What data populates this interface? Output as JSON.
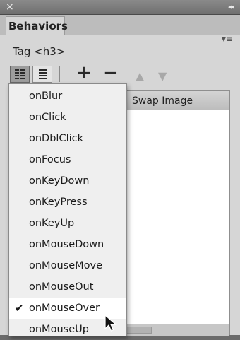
{
  "window": {
    "close_glyph": "×",
    "collapse_glyph": "◂◂"
  },
  "tabs": {
    "active_label": "Behaviors",
    "panel_menu_glyph": "▾≡"
  },
  "tag_label": "Tag <h3>",
  "toolbar": {
    "add_glyph": "+",
    "remove_glyph": "−",
    "up_glyph": "▲",
    "down_glyph": "▼"
  },
  "table": {
    "columns": [
      "",
      "Swap Image"
    ]
  },
  "event_menu": {
    "items": [
      {
        "label": "onBlur",
        "checked": false
      },
      {
        "label": "onClick",
        "checked": false
      },
      {
        "label": "onDblClick",
        "checked": false
      },
      {
        "label": "onFocus",
        "checked": false
      },
      {
        "label": "onKeyDown",
        "checked": false
      },
      {
        "label": "onKeyPress",
        "checked": false
      },
      {
        "label": "onKeyUp",
        "checked": false
      },
      {
        "label": "onMouseDown",
        "checked": false
      },
      {
        "label": "onMouseMove",
        "checked": false
      },
      {
        "label": "onMouseOut",
        "checked": false
      },
      {
        "label": "onMouseOver",
        "checked": true
      },
      {
        "label": "onMouseUp",
        "checked": false
      }
    ],
    "check_glyph": "✔"
  }
}
